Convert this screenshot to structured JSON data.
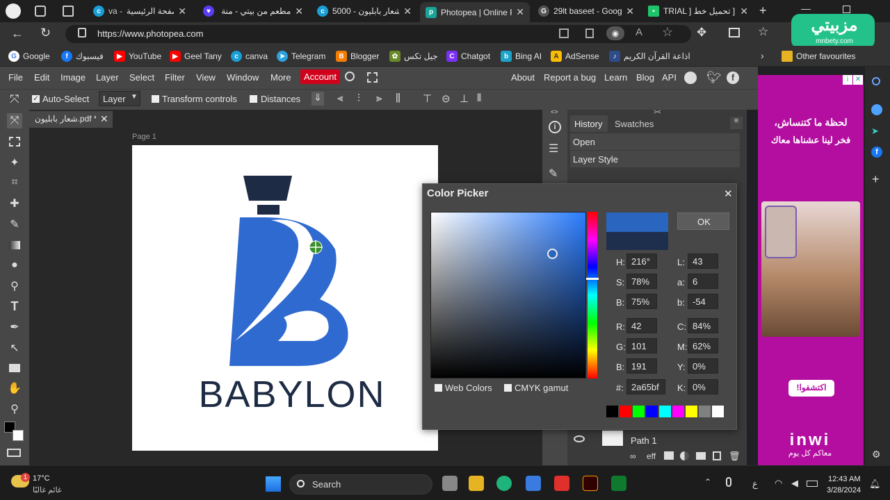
{
  "browser": {
    "tabs": [
      {
        "title": "الصفحة الرئيسية",
        "prefix": "va -"
      },
      {
        "title": "مطعم من بيتي - منة"
      },
      {
        "title": "5000 - شعار بابليون"
      },
      {
        "title": "Photopea | Online P"
      },
      {
        "title": "29lt baseet - Googl"
      },
      {
        "title": "TRIAL ] تحميل خط ]"
      }
    ],
    "url": "https://www.photopea.com",
    "favorites": [
      "Google",
      "فيسبوك",
      "YouTube",
      "Geel Tany",
      "canva",
      "Telegram",
      "Blogger",
      "جيل تكس",
      "Chatgot",
      "Bing AI",
      "AdSense",
      "اذاعة القرآن الكريم",
      "Other favourites"
    ]
  },
  "photopea": {
    "menu": [
      "File",
      "Edit",
      "Image",
      "Layer",
      "Select",
      "Filter",
      "View",
      "Window",
      "More",
      "Account"
    ],
    "menu_right": [
      "About",
      "Report a bug",
      "Learn",
      "Blog",
      "API"
    ],
    "options": {
      "auto_select": "Auto-Select",
      "layer_select": "Layer",
      "transform_controls": "Transform controls",
      "distances": "Distances"
    },
    "document_tab": "شعار بابليون.pdf *",
    "page_label": "Page 1",
    "logo_text": "BABYLON",
    "panel": {
      "tabs": [
        "History",
        "Swatches"
      ],
      "history": [
        "Open",
        "Layer Style"
      ],
      "layer_name": "Path 1",
      "layer_icons": "eff"
    },
    "color_picker": {
      "title": "Color Picker",
      "ok": "OK",
      "fields": {
        "H": {
          "label": "H:",
          "value": "216°"
        },
        "S": {
          "label": "S:",
          "value": "78%"
        },
        "Bv": {
          "label": "B:",
          "value": "75%"
        },
        "L": {
          "label": "L:",
          "value": "43"
        },
        "a": {
          "label": "a:",
          "value": "6"
        },
        "b": {
          "label": "b:",
          "value": "-54"
        },
        "R": {
          "label": "R:",
          "value": "42"
        },
        "G": {
          "label": "G:",
          "value": "101"
        },
        "B": {
          "label": "B:",
          "value": "191"
        },
        "C": {
          "label": "C:",
          "value": "84%"
        },
        "M": {
          "label": "M:",
          "value": "62%"
        },
        "Y": {
          "label": "Y:",
          "value": "0%"
        },
        "K": {
          "label": "K:",
          "value": "0%"
        },
        "hex": {
          "label": "#:",
          "value": "2a65bf"
        }
      },
      "web_colors": "Web Colors",
      "cmyk_gamut": "CMYK gamut",
      "new_color": "#2a65bf",
      "old_color": "#1e2f4e",
      "swatches": [
        "#000000",
        "#ff0000",
        "#00ff00",
        "#0000ff",
        "#00ffff",
        "#ff00ff",
        "#ffff00",
        "#808080",
        "#ffffff"
      ]
    }
  },
  "ad": {
    "line1": "لحظة ما كتنساش،",
    "line2": "فخر لينا عشناها معاك",
    "cta": "اكتشفوا!",
    "brand": "inwi",
    "tagline": "معاكم كل يوم",
    "site_logo": "مزبيتي",
    "site_url": "mnbety.com"
  },
  "taskbar": {
    "weather_temp": "17°C",
    "weather_desc": "غائم غالبًا",
    "weather_badge": "1",
    "search": "Search",
    "lang": "ع",
    "time": "12:43 AM",
    "date": "3/28/2024"
  },
  "colors": {
    "logo_blue": "#2f6ad0",
    "logo_dark": "#1e2b45",
    "account_red": "#d0021b",
    "ad_magenta": "#b40ea0"
  }
}
